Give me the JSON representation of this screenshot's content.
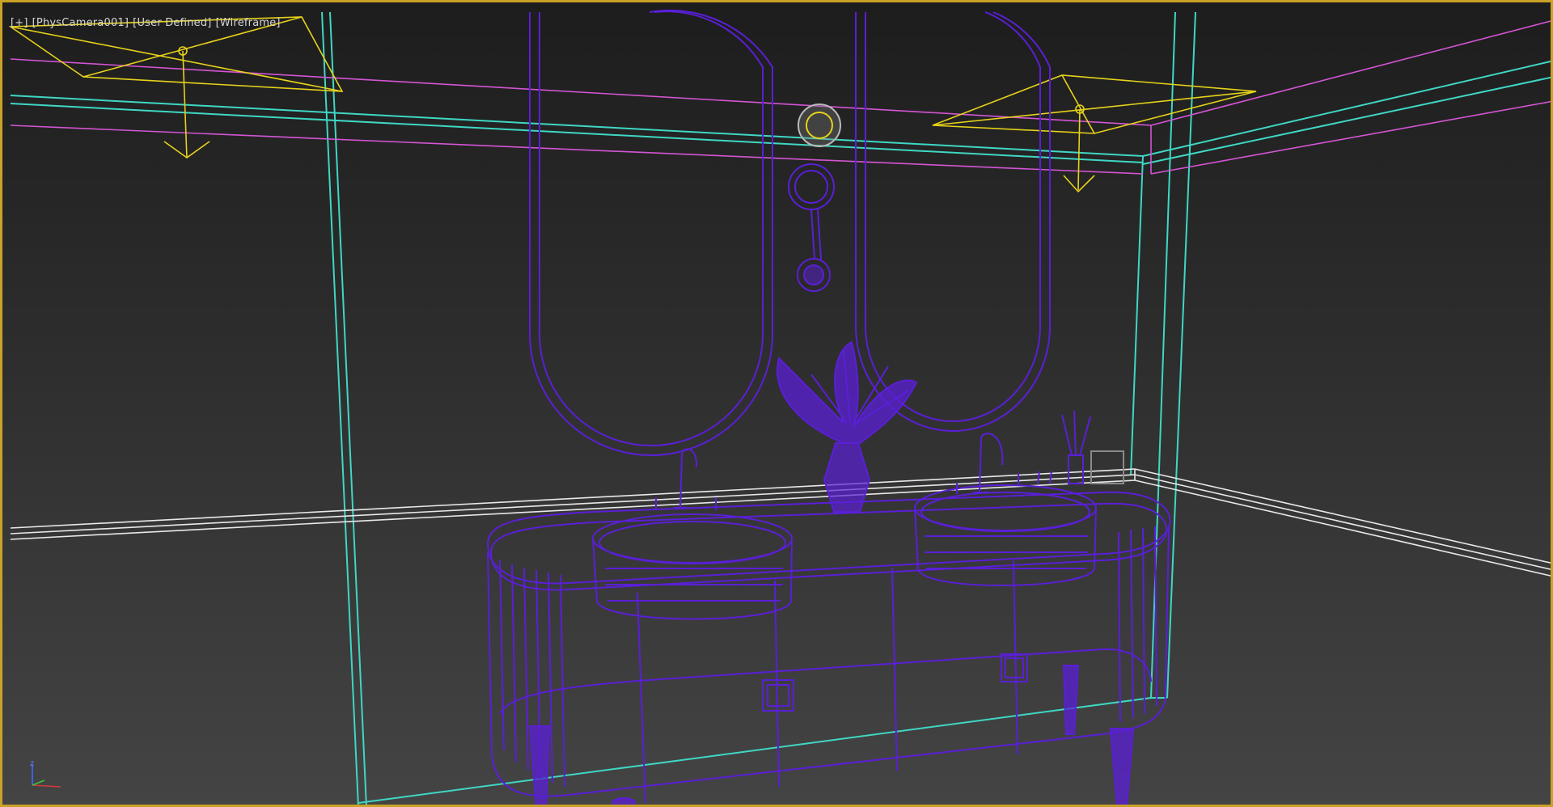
{
  "viewport": {
    "labels": [
      "[+]",
      "[PhysCamera001]",
      "[User Defined]",
      "[Wireframe]"
    ],
    "axis_z_label": "z"
  },
  "colors": {
    "frame_border": "#c9a227",
    "room_edges": "#3fd7c4",
    "ceiling_molding": "#d455d4",
    "lights": "#e6d21a",
    "vanity_wireframe": "#5a1fd6",
    "baseboard": "#e8e8e8"
  },
  "icons": [
    "photometric-light-icon",
    "axis-tripod-icon"
  ]
}
